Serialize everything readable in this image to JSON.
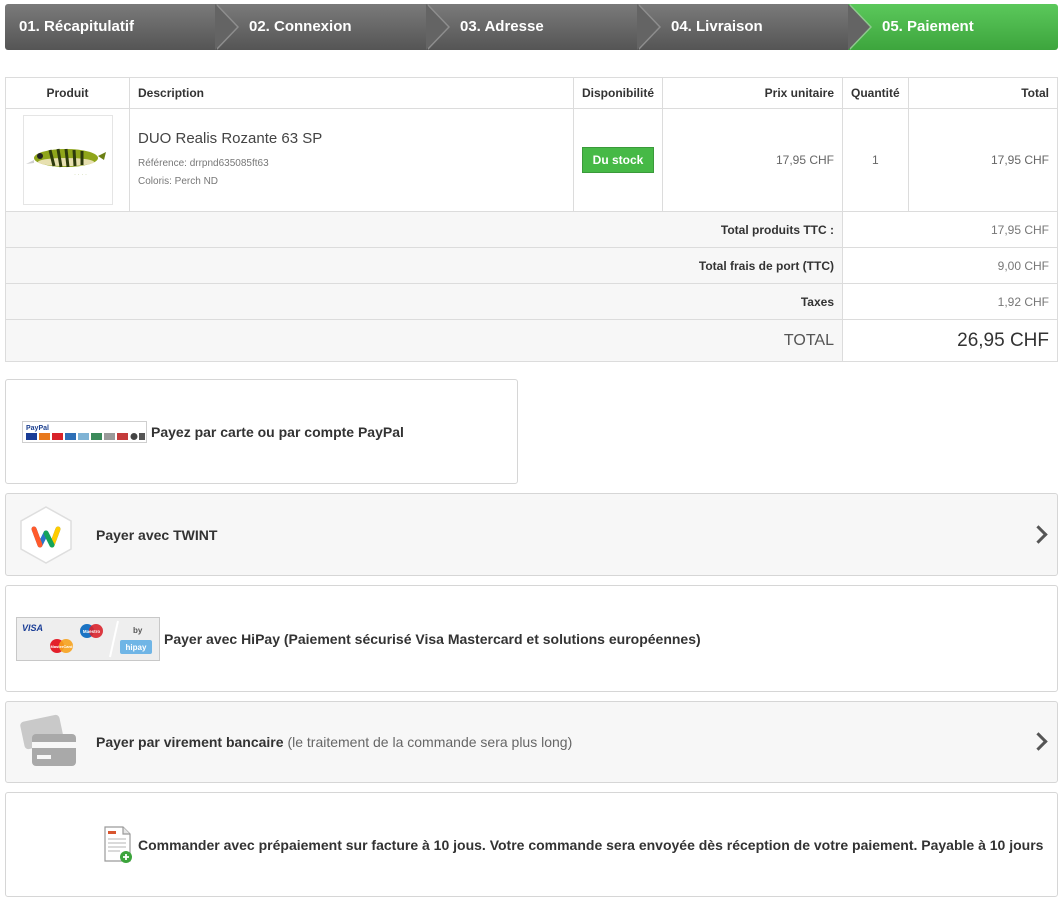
{
  "steps": [
    {
      "label": "01. Récapitulatif",
      "active": false
    },
    {
      "label": "02. Connexion",
      "active": false
    },
    {
      "label": "03. Adresse",
      "active": false
    },
    {
      "label": "04. Livraison",
      "active": false
    },
    {
      "label": "05. Paiement",
      "active": true
    }
  ],
  "cart": {
    "headers": {
      "product": "Produit",
      "description": "Description",
      "availability": "Disponibilité",
      "unit_price": "Prix unitaire",
      "quantity": "Quantité",
      "total": "Total"
    },
    "item": {
      "name": "DUO Realis Rozante 63 SP",
      "reference": "Référence: drrpnd635085ft63",
      "color": "Coloris: Perch ND",
      "availability": "Du stock",
      "unit_price": "17,95 CHF",
      "quantity": "1",
      "total": "17,95 CHF"
    },
    "summary": [
      {
        "label": "Total produits TTC :",
        "value": "17,95 CHF"
      },
      {
        "label": "Total frais de port (TTC)",
        "value": "9,00 CHF"
      },
      {
        "label": "Taxes",
        "value": "1,92 CHF"
      }
    ],
    "grand_total": {
      "label": "TOTAL",
      "value": "26,95 CHF"
    }
  },
  "payments": {
    "paypal": {
      "label": "Payez par carte ou par compte PayPal",
      "logo_text": "PayPal"
    },
    "twint": {
      "label": "Payer avec TWINT"
    },
    "hipay": {
      "label": "Payer avec HiPay (Paiement sécurisé Visa Mastercard et solutions européennes)",
      "logo_visa": "VISA",
      "logo_maestro": "Maestro",
      "logo_mastercard": "MasterCard",
      "logo_by": "by",
      "logo_hipay": "hipay"
    },
    "transfer": {
      "label": "Payer par virement bancaire",
      "note": "(le traitement de la commande sera plus long)"
    },
    "invoice": {
      "label": "Commander avec prépaiement sur facture à 10 jous. Votre commande sera envoyée dès réception de votre paiement. Payable à 10 jours"
    }
  },
  "colors": {
    "step_active": "#46b946",
    "step_default": "#666666",
    "stock_badge": "#46b946"
  }
}
